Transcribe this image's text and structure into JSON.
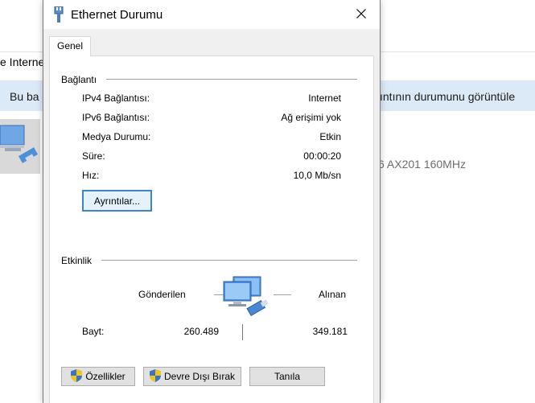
{
  "background_window": {
    "breadcrumb": "e Interne",
    "info_left": "Bu ba",
    "info_right": "ıntının durumunu görüntüle",
    "adapter_text": "6 AX201 160MHz"
  },
  "dialog": {
    "title": "Ethernet Durumu",
    "tab_general": "Genel",
    "connection_group": "Bağlantı",
    "rows": [
      {
        "label": "IPv4 Bağlantısı:",
        "value": "Internet"
      },
      {
        "label": "IPv6 Bağlantısı:",
        "value": "Ağ erişimi yok"
      },
      {
        "label": "Medya Durumu:",
        "value": "Etkin"
      },
      {
        "label": "Süre:",
        "value": "00:00:20"
      },
      {
        "label": "Hız:",
        "value": "10,0 Mb/sn"
      }
    ],
    "details_button": "Ayrıntılar...",
    "activity_group": "Etkinlik",
    "sent_label": "Gönderilen",
    "received_label": "Alınan",
    "bytes_label": "Bayt:",
    "bytes_sent": "260.489",
    "bytes_received": "349.181",
    "properties_button": "Özellikler",
    "disable_button": "Devre Dışı Bırak",
    "diagnose_button": "Tanıla"
  },
  "icons": {
    "title_icon": "ethernet-plug-icon",
    "close": "close-icon",
    "network": "network-computers-icon",
    "shield": "uac-shield-icon"
  }
}
